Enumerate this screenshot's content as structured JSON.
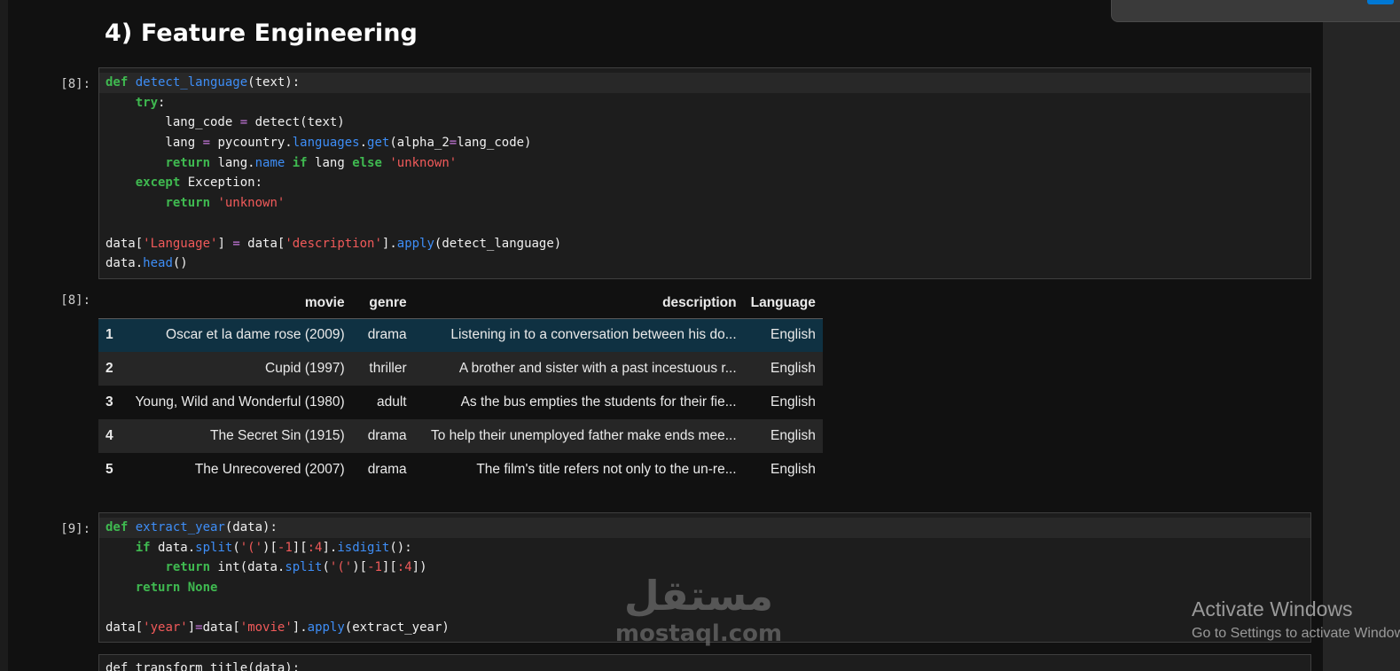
{
  "section_heading": "4) Feature Engineering",
  "cells": [
    {
      "prompt": "[8]:",
      "code_lines": [
        [
          [
            "kw",
            "def "
          ],
          [
            "fn",
            "detect_language"
          ],
          [
            "",
            "(text):"
          ]
        ],
        [
          [
            "",
            "    "
          ],
          [
            "kw",
            "try"
          ],
          [
            "",
            ":"
          ]
        ],
        [
          [
            "",
            "        lang_code "
          ],
          [
            "op",
            "="
          ],
          [
            "",
            " detect(text)"
          ]
        ],
        [
          [
            "",
            "        lang "
          ],
          [
            "op",
            "="
          ],
          [
            "",
            " pycountry."
          ],
          [
            "at",
            "languages"
          ],
          [
            "",
            "."
          ],
          [
            "at",
            "get"
          ],
          [
            "",
            "(alpha_2"
          ],
          [
            "op",
            "="
          ],
          [
            "",
            "lang_code)"
          ]
        ],
        [
          [
            "",
            "        "
          ],
          [
            "kw",
            "return"
          ],
          [
            "",
            " lang."
          ],
          [
            "at",
            "name"
          ],
          [
            "",
            " "
          ],
          [
            "kw",
            "if"
          ],
          [
            "",
            " lang "
          ],
          [
            "kw",
            "else"
          ],
          [
            "",
            " "
          ],
          [
            "st",
            "'unknown'"
          ]
        ],
        [
          [
            "",
            "    "
          ],
          [
            "kw",
            "except"
          ],
          [
            "",
            " Exception:"
          ]
        ],
        [
          [
            "",
            "        "
          ],
          [
            "kw",
            "return"
          ],
          [
            "",
            " "
          ],
          [
            "st",
            "'unknown'"
          ]
        ],
        [
          [
            "",
            ""
          ]
        ],
        [
          [
            "",
            "data["
          ],
          [
            "st",
            "'Language'"
          ],
          [
            "",
            "] "
          ],
          [
            "op",
            "="
          ],
          [
            "",
            " data["
          ],
          [
            "st",
            "'description'"
          ],
          [
            "",
            "]."
          ],
          [
            "at",
            "apply"
          ],
          [
            "",
            "(detect_language)"
          ]
        ],
        [
          [
            "",
            "data."
          ],
          [
            "at",
            "head"
          ],
          [
            "",
            "()"
          ]
        ]
      ]
    },
    {
      "prompt": "[9]:",
      "code_lines": [
        [
          [
            "kw",
            "def "
          ],
          [
            "fn",
            "extract_year"
          ],
          [
            "",
            "(data):"
          ]
        ],
        [
          [
            "",
            "    "
          ],
          [
            "kw",
            "if"
          ],
          [
            "",
            " data."
          ],
          [
            "at",
            "split"
          ],
          [
            "",
            "("
          ],
          [
            "st",
            "'('"
          ],
          [
            "",
            ")["
          ],
          [
            "st",
            "-1"
          ],
          [
            "",
            "]["
          ],
          [
            "st",
            ":4"
          ],
          [
            "",
            "]."
          ],
          [
            "at",
            "isdigit"
          ],
          [
            "",
            "():"
          ]
        ],
        [
          [
            "",
            "        "
          ],
          [
            "kw",
            "return"
          ],
          [
            "",
            " int(data."
          ],
          [
            "at",
            "split"
          ],
          [
            "",
            "("
          ],
          [
            "st",
            "'('"
          ],
          [
            "",
            ")["
          ],
          [
            "st",
            "-1"
          ],
          [
            "",
            "]["
          ],
          [
            "st",
            ":4"
          ],
          [
            "",
            "])"
          ]
        ],
        [
          [
            "",
            "    "
          ],
          [
            "kw",
            "return"
          ],
          [
            "",
            " "
          ],
          [
            "kw",
            "None"
          ]
        ],
        [
          [
            "",
            ""
          ]
        ],
        [
          [
            "",
            "data["
          ],
          [
            "st",
            "'year'"
          ],
          [
            "",
            "]"
          ],
          [
            "op",
            "="
          ],
          [
            "",
            "data["
          ],
          [
            "st",
            "'movie'"
          ],
          [
            "",
            "]."
          ],
          [
            "at",
            "apply"
          ],
          [
            "",
            "(extract_year)"
          ]
        ]
      ]
    }
  ],
  "output": {
    "prompt": "[8]:",
    "columns": [
      "",
      "movie",
      "genre",
      "description",
      "Language"
    ],
    "rows": [
      [
        "1",
        "Oscar et la dame rose (2009)",
        "drama",
        "Listening in to a conversation between his do...",
        "English"
      ],
      [
        "2",
        "Cupid (1997)",
        "thriller",
        "A brother and sister with a past incestuous r...",
        "English"
      ],
      [
        "3",
        "Young, Wild and Wonderful (1980)",
        "adult",
        "As the bus empties the students for their fie...",
        "English"
      ],
      [
        "4",
        "The Secret Sin (1915)",
        "drama",
        "To help their unemployed father make ends mee...",
        "English"
      ],
      [
        "5",
        "The Unrecovered (2007)",
        "drama",
        "The film's title refers not only to the un-re...",
        "English"
      ]
    ]
  },
  "next_cell_partial": "def transform_title(data):",
  "watermark": {
    "logo": "مستقل",
    "url": "mostaql.com"
  },
  "activate_windows": {
    "title": "Activate Windows",
    "subtitle": "Go to Settings to activate Windows."
  }
}
